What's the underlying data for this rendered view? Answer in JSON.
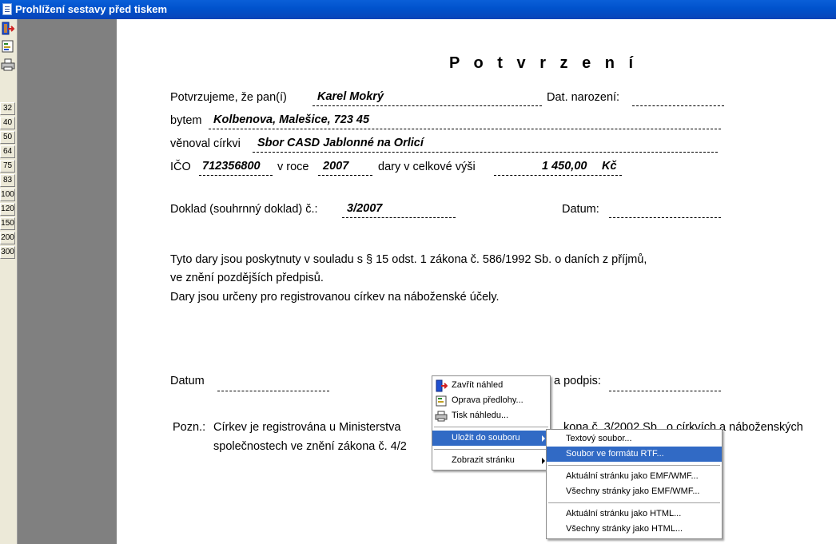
{
  "window": {
    "title": "Prohlížení sestavy před tiskem"
  },
  "zoom_levels": [
    "32",
    "40",
    "50",
    "64",
    "75",
    "83",
    "100",
    "120",
    "150",
    "200",
    "300"
  ],
  "report": {
    "heading": "P o t v r z e n í",
    "line1": {
      "label": "Potvrzujeme, že pan(í)",
      "name": "Karel Mokrý",
      "dob_label": "Dat. narození:"
    },
    "line2": {
      "label": "bytem",
      "address": "Kolbenova, Malešice, 723 45"
    },
    "line3": {
      "label": "věnoval církvi",
      "church": "Sbor CASD Jablonné na Orlicí"
    },
    "line4": {
      "ico_label": "IČO",
      "ico": "712356800",
      "year_label": "v roce",
      "year": "2007",
      "amount_label": "dary v celkové výši",
      "amount": "1 450,00",
      "currency": "Kč"
    },
    "line5": {
      "doc_label": "Doklad (souhrnný doklad) č.:",
      "doc_no": "3/2007",
      "date_label": "Datum:"
    },
    "para1": "Tyto dary jsou poskytnuty v souladu s § 15 odst. 1 zákona č. 586/1992 Sb. o daních z příjmů,",
    "para2": "ve znění pozdějších předpisů.",
    "para3": "Dary jsou určeny pro registrovanou církev na náboženské účely.",
    "sign": {
      "date_label": "Datum",
      "sign_label": "a podpis:"
    },
    "note": {
      "label": "Pozn.:",
      "line1_left": "Církev je registrována u Ministerstva",
      "line1_right": "kona č. 3/2002 Sb., o církvích a náboženských",
      "line2_left": "společnostech ve znění zákona č. 4/2"
    }
  },
  "context_menu": {
    "items": [
      {
        "label": "Zavřít náhled"
      },
      {
        "label": "Oprava předlohy..."
      },
      {
        "label": "Tisk náhledu..."
      },
      {
        "label": "Uložit do souboru"
      },
      {
        "label": "Zobrazit stránku"
      }
    ]
  },
  "submenu": {
    "items": [
      {
        "label": "Textový soubor..."
      },
      {
        "label": "Soubor ve formátu RTF..."
      },
      {
        "label": "Aktuální stránku jako EMF/WMF..."
      },
      {
        "label": "Všechny stránky jako EMF/WMF..."
      },
      {
        "label": "Aktuální stránku jako HTML..."
      },
      {
        "label": "Všechny stránky jako HTML..."
      }
    ]
  }
}
